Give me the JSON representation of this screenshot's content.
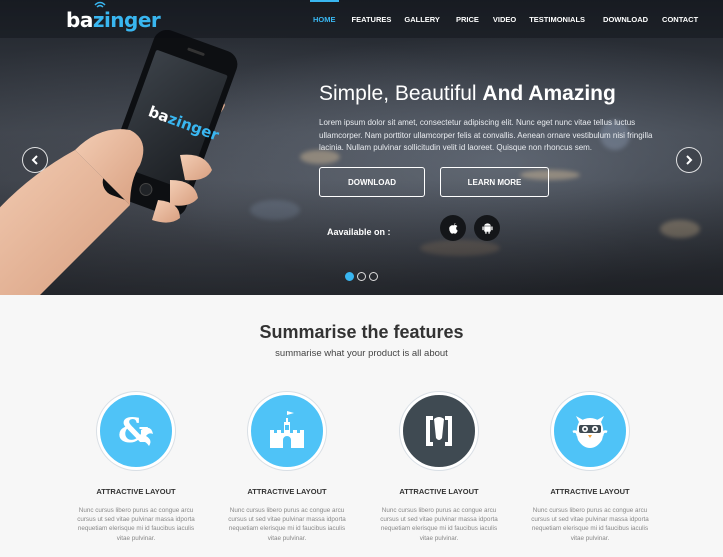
{
  "brand": {
    "name_prefix": "ba",
    "name_suffix": "zinger",
    "accent": "#39b6f0"
  },
  "nav": {
    "items": [
      {
        "label": "HOME",
        "active": true
      },
      {
        "label": "FEATURES"
      },
      {
        "label": "GALLERY"
      },
      {
        "label": "PRICE"
      },
      {
        "label": "VIDEO"
      },
      {
        "label": "TESTIMONIALS"
      },
      {
        "label": "DOWNLOAD"
      },
      {
        "label": "CONTACT"
      }
    ]
  },
  "hero": {
    "title_light": "Simple, Beautiful ",
    "title_bold": "And Amazing",
    "description": "Lorem ipsum dolor sit amet, consectetur adipiscing elit. Nunc eget nunc vitae tellus luctus ullamcorper. Nam porttitor ullamcorper felis at convallis. Aenean ornare vestibulum nisi fringilla lacinia. Nullam pulvinar sollicitudin velit id laoreet. Quisque non rhoncus sem.",
    "download_label": "DOWNLOAD",
    "learn_more_label": "LEARN MORE",
    "available_label": "Aavailable on :",
    "phone_logo_prefix": "ba",
    "phone_logo_suffix": "zinger",
    "slides_total": 3,
    "slide_active": 1
  },
  "features": {
    "title": "Summarise the features",
    "subtitle": "summarise what your product is all about",
    "items": [
      {
        "title": "ATTRACTIVE LAYOUT",
        "icon": "ampersand-dragon-icon",
        "color": "#4fc3f7",
        "desc": "Nunc cursus libero purus ac congue arcu cursus ut sed vitae pulvinar massa idporta nequetiam elerisque mi id faucibus iaculis vitae pulvinar."
      },
      {
        "title": "ATTRACTIVE LAYOUT",
        "icon": "castle-icon",
        "color": "#4fc3f7",
        "desc": "Nunc cursus libero purus ac congue arcu cursus ut sed vitae pulvinar massa idporta nequetiam elerisque mi id faucibus iaculis vitae pulvinar."
      },
      {
        "title": "ATTRACTIVE LAYOUT",
        "icon": "bracket-logo-icon",
        "color": "#3f4a52",
        "desc": "Nunc cursus libero purus ac congue arcu cursus ut sed vitae pulvinar massa idporta nequetiam elerisque mi id faucibus iaculis vitae pulvinar."
      },
      {
        "title": "ATTRACTIVE LAYOUT",
        "icon": "owl-icon",
        "color": "#4fc3f7",
        "desc": "Nunc cursus libero purus ac congue arcu cursus ut sed vitae pulvinar massa idporta nequetiam elerisque mi id faucibus iaculis vitae pulvinar."
      }
    ]
  }
}
